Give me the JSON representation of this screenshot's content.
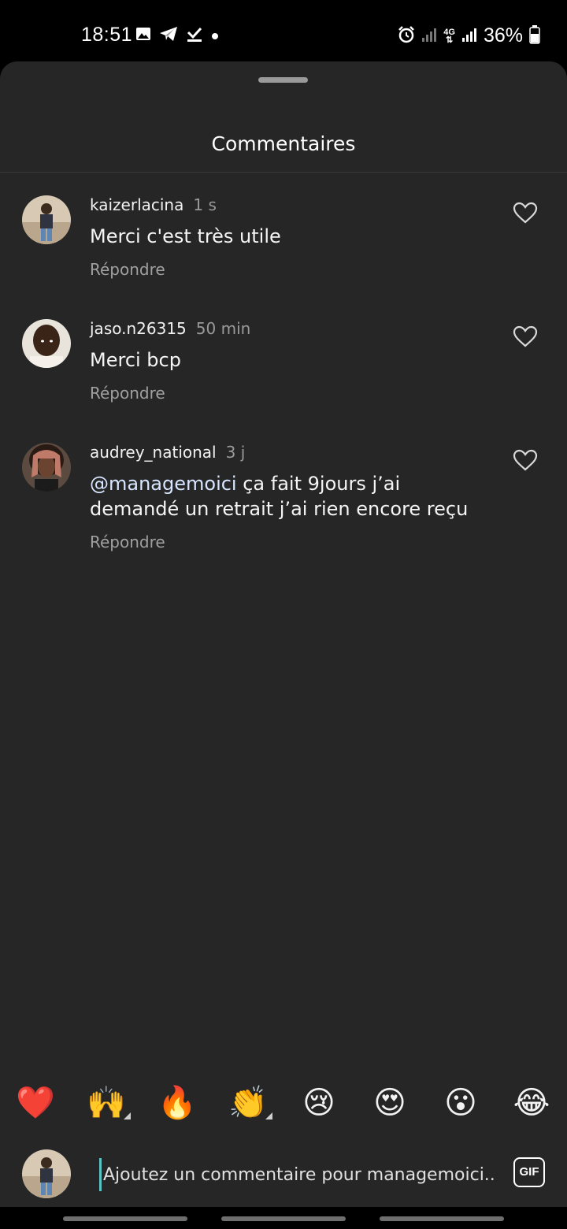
{
  "status_bar": {
    "time": "18:51",
    "left_icons": [
      "image-icon",
      "telegram-icon",
      "download-done-icon",
      "dot-icon"
    ],
    "right_icons": [
      "alarm-icon",
      "signal-icon",
      "4g-icon",
      "signal-icon",
      "battery-icon"
    ],
    "network_label_top": "4G",
    "battery": "36%"
  },
  "sheet": {
    "title": "Commentaires"
  },
  "comments": [
    {
      "username": "kaizerlacina",
      "time": "1 s",
      "text": "Merci c'est très utile",
      "reply_label": "Répondre"
    },
    {
      "username": "jaso.n26315",
      "time": "50 min",
      "text": "Merci bcp",
      "reply_label": "Répondre"
    },
    {
      "username": "audrey_national",
      "time": "3 j",
      "mention": "@managemoici",
      "text": " ça fait 9jours j’ai demandé un retrait j’ai rien encore reçu",
      "reply_label": "Répondre"
    }
  ],
  "emoji_bar": {
    "emojis": [
      "❤️",
      "🙌",
      "🔥",
      "👏",
      "😢",
      "😍",
      "😮",
      "😂"
    ]
  },
  "composer": {
    "placeholder": "Ajoutez un commentaire pour managemoici...",
    "gif_label": "GIF"
  },
  "colors": {
    "background": "#262626",
    "accent_cursor": "#59c3c3",
    "mention": "#d8e6ff"
  }
}
